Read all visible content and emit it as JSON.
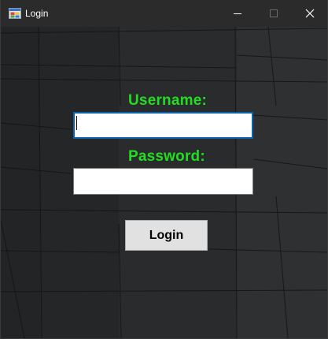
{
  "window": {
    "title": "Login",
    "icon": "app-window-icon",
    "controls": {
      "minimize_icon": "minimize-icon",
      "maximize_icon": "maximize-icon",
      "close_icon": "close-icon"
    }
  },
  "form": {
    "username_label": "Username:",
    "username_value": "",
    "password_label": "Password:",
    "password_value": "",
    "login_label": "Login"
  },
  "colors": {
    "label": "#22dd22",
    "titlebar": "#2b2b2b",
    "background": "#252627",
    "focus_border": "#0a64ad",
    "button": "#e1e1e1"
  }
}
